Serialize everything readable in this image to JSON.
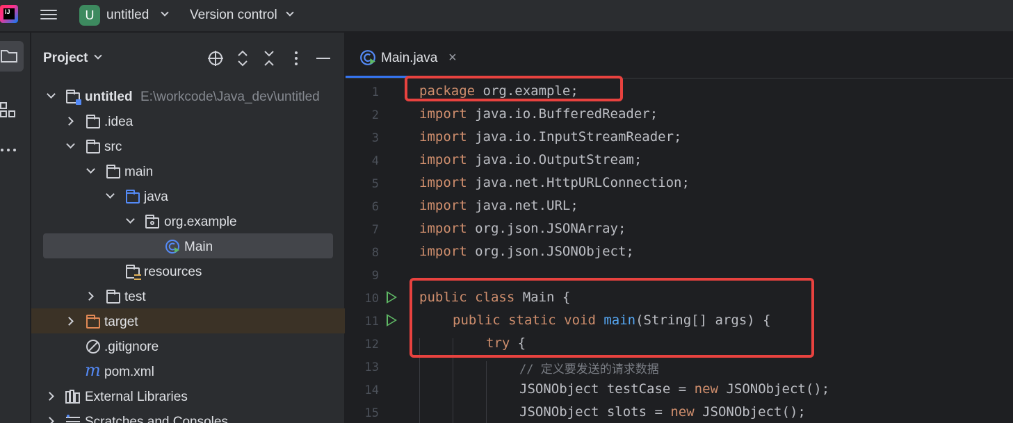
{
  "titlebar": {
    "logo_text": "IJ",
    "project_initial": "U",
    "project_name": "untitled",
    "vcs_label": "Version control"
  },
  "project_panel": {
    "title": "Project",
    "tree": [
      {
        "label": "untitled",
        "path": "E:\\workcode\\Java_dev\\untitled"
      },
      {
        "label": ".idea"
      },
      {
        "label": "src"
      },
      {
        "label": "main"
      },
      {
        "label": "java"
      },
      {
        "label": "org.example"
      },
      {
        "label": "Main"
      },
      {
        "label": "resources"
      },
      {
        "label": "test"
      },
      {
        "label": "target"
      },
      {
        "label": ".gitignore"
      },
      {
        "label": "pom.xml"
      },
      {
        "label": "External Libraries"
      },
      {
        "label": "Scratches and Consoles"
      }
    ]
  },
  "editor": {
    "tab": {
      "label": "Main.java",
      "close": "×"
    },
    "line_numbers": [
      "1",
      "2",
      "3",
      "4",
      "5",
      "6",
      "7",
      "8",
      "9",
      "10",
      "11",
      "12",
      "13",
      "14",
      "15"
    ],
    "lines": [
      {
        "kw": "package",
        "rest": " org.example;"
      },
      {
        "kw": "import",
        "rest": " java.io.BufferedReader;"
      },
      {
        "kw": "import",
        "rest": " java.io.InputStreamReader;"
      },
      {
        "kw": "import",
        "rest": " java.io.OutputStream;"
      },
      {
        "kw": "import",
        "rest": " java.net.HttpURLConnection;"
      },
      {
        "kw": "import",
        "rest": " java.net.URL;"
      },
      {
        "kw": "import",
        "rest": " org.json.JSONArray;"
      },
      {
        "kw": "import",
        "rest": " org.json.JSONObject;"
      },
      {},
      {
        "kw": "public class",
        "rest": " Main {"
      },
      {
        "kw": "public static void",
        "fn": " main",
        "rest": "(String[] args) {"
      },
      {
        "kw": "try",
        "rest": " {"
      },
      {
        "comment": "// 定义要发送的请求数据"
      },
      {
        "pre": "JSONObject testCase = ",
        "kw": "new",
        "rest": " JSONObject();"
      },
      {
        "pre": "JSONObject slots = ",
        "kw": "new",
        "rest": " JSONObject();"
      }
    ]
  },
  "colors": {
    "keyword": "#cf8e6d",
    "function": "#56a8f5",
    "comment": "#7a7e85",
    "highlight_box": "#e8423f",
    "run_gutter": "#5fb865"
  }
}
